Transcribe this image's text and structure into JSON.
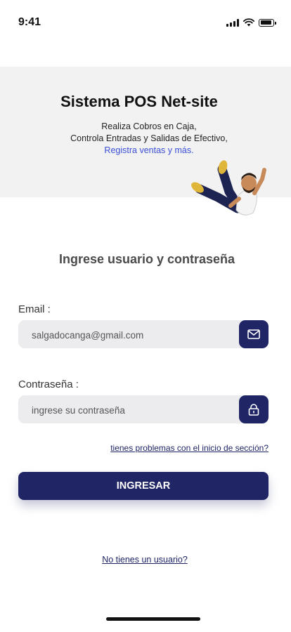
{
  "status_bar": {
    "time": "9:41",
    "icons": [
      "signal-icon",
      "wifi-icon",
      "battery-icon"
    ]
  },
  "header": {
    "title": "Sistema POS Net-site",
    "line1": "Realiza Cobros en Caja,",
    "line2": "Controla Entradas y Salidas de Efectivo,",
    "line3": "Registra ventas y más."
  },
  "form": {
    "heading": "Ingrese usuario y contraseña",
    "email_label": "Email :",
    "email_value": "salgadocanga@gmail.com",
    "email_icon": "mail-icon",
    "password_label": "Contraseña :",
    "password_placeholder": "ingrese su contraseña",
    "password_icon": "lock-icon",
    "forgot_link": "tienes problemas con el inicio de sección?",
    "login_button": "INGRESAR",
    "signup_link": "No tienes un usuario?"
  },
  "colors": {
    "primary": "#1f2565",
    "accent_link": "#3b4fd6",
    "header_bg": "#f2f2f3",
    "field_bg": "#ececee"
  }
}
